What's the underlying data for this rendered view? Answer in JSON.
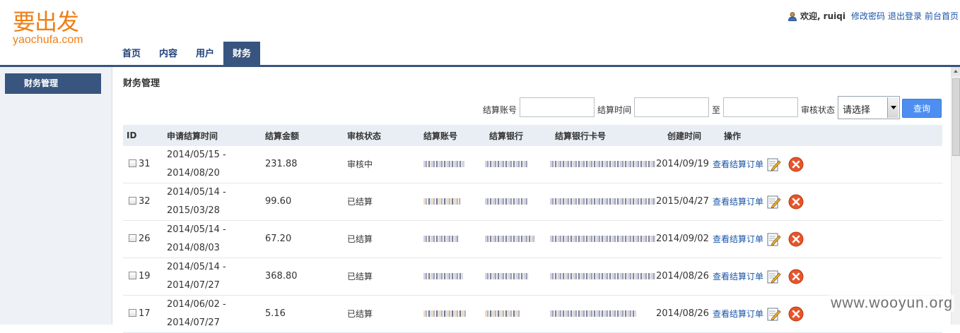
{
  "logo": {
    "cn": "要出发",
    "en": "yaochufa.com"
  },
  "userbar": {
    "welcome": "欢迎, ruiqi",
    "change_password": "修改密码",
    "logout": "退出登录",
    "frontend_home": "前台首页"
  },
  "nav": {
    "tabs": [
      "首页",
      "内容",
      "用户",
      "财务"
    ],
    "active": "财务"
  },
  "sidebar": {
    "items": [
      "财务管理"
    ]
  },
  "main": {
    "title": "财务管理",
    "filter": {
      "account_label": "结算账号",
      "time_label": "结算时间",
      "to_label": "至",
      "status_label": "审核状态",
      "status_selected": "请选择",
      "query_button": "查询"
    },
    "columns": [
      "ID",
      "申请结算时间",
      "结算金额",
      "审核状态",
      "结算账号",
      "结算银行",
      "结算银行卡号",
      "创建时间",
      "操作"
    ],
    "rows": [
      {
        "id": "31",
        "period_start": "2014/05/15 -",
        "period_end": "2014/08/20",
        "amount": "231.88",
        "status": "审核中",
        "created": "2014/09/19",
        "op": "查看结算订单"
      },
      {
        "id": "32",
        "period_start": "2014/05/14 -",
        "period_end": "2015/03/28",
        "amount": "99.60",
        "status": "已结算",
        "created": "2015/04/27",
        "op": "查看结算订单"
      },
      {
        "id": "26",
        "period_start": "2014/05/14 -",
        "period_end": "2014/08/03",
        "amount": "67.20",
        "status": "已结算",
        "created": "2014/09/02",
        "op": "查看结算订单"
      },
      {
        "id": "19",
        "period_start": "2014/05/14 -",
        "period_end": "2014/07/27",
        "amount": "368.80",
        "status": "已结算",
        "created": "2014/08/26",
        "op": "查看结算订单"
      },
      {
        "id": "17",
        "period_start": "2014/06/02 -",
        "period_end": "2014/07/27",
        "amount": "5.16",
        "status": "已结算",
        "created": "2014/08/26",
        "op": "查看结算订单"
      }
    ]
  },
  "watermark": "www.wooyun.org",
  "colors": {
    "brand_orange": "#f07f16",
    "nav_blue": "#38557f",
    "link_blue": "#1a56a8",
    "button_blue": "#4d8ff0",
    "delete_red": "#e8542a"
  },
  "icons": [
    "user-icon",
    "edit-icon",
    "delete-icon"
  ]
}
